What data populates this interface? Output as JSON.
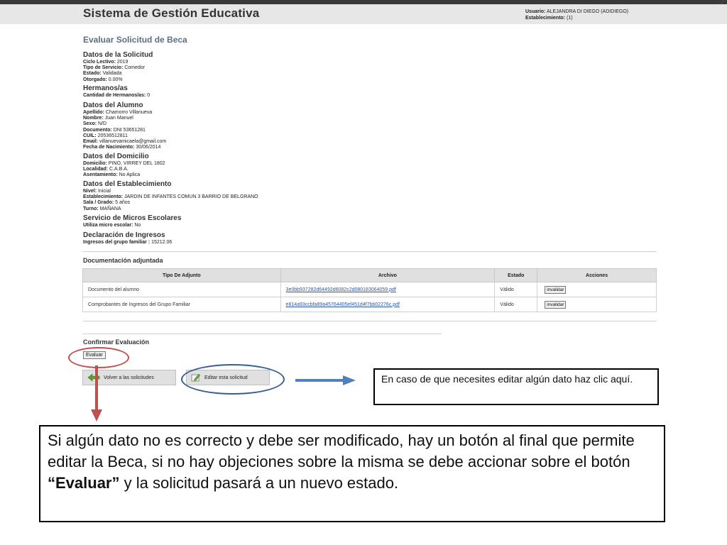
{
  "header": {
    "app_title": "Sistema de Gestión Educativa",
    "user_label": "Usuario:",
    "user_value": "ALEJANDRA DI DIEGO (ADIDIEGO)",
    "establishment_label": "Establecimiento:",
    "establishment_value": "(1)"
  },
  "page_title": "Evaluar Solicitud de Beca",
  "solicitud": {
    "title": "Datos de la Solicitud",
    "rows": [
      {
        "label": "Ciclo Lectivo:",
        "value": "2019"
      },
      {
        "label": "Tipo de Servicio:",
        "value": "Comedor"
      },
      {
        "label": "Estado:",
        "value": "Validada"
      },
      {
        "label": "Otorgado:",
        "value": "0.00%"
      }
    ]
  },
  "hermanos": {
    "title": "Hermanos/as",
    "rows": [
      {
        "label": "Cantidad de Hermanos/as:",
        "value": "0"
      }
    ]
  },
  "alumno": {
    "title": "Datos del Alumno",
    "rows": [
      {
        "label": "Apellido:",
        "value": "Chamorro Villanueva"
      },
      {
        "label": "Nombre:",
        "value": "Juan Manuel"
      },
      {
        "label": "Sexo:",
        "value": "N/D"
      },
      {
        "label": "Documento:",
        "value": "DNI 53651281"
      },
      {
        "label": "CUIL:",
        "value": "20536512811"
      },
      {
        "label": "Email:",
        "value": "villanuevamicaela@gmail.com"
      },
      {
        "label": "Fecha de Nacimiento:",
        "value": "30/06/2014"
      }
    ]
  },
  "domicilio": {
    "title": "Datos del Domicilio",
    "rows": [
      {
        "label": "Domicilio:",
        "value": "PINO, VIRREY DEL 1802"
      },
      {
        "label": "Localidad:",
        "value": "C.A.B.A."
      },
      {
        "label": "Asentamiento:",
        "value": "No Aplica"
      }
    ]
  },
  "establecimiento": {
    "title": "Datos del Establecimiento",
    "rows": [
      {
        "label": "Nivel:",
        "value": "Inicial"
      },
      {
        "label": "Establecimiento:",
        "value": "JARDIN DE INFANTES COMUN 3 BARRIO DE BELGRANO"
      },
      {
        "label": "Sala / Grado:",
        "value": "5 años"
      },
      {
        "label": "Turno:",
        "value": "MAÑANA"
      }
    ]
  },
  "micros": {
    "title": "Servicio de Micros Escolares",
    "rows": [
      {
        "label": "Utiliza micro escolar:",
        "value": "No"
      }
    ]
  },
  "ingresos": {
    "title": "Declaración de Ingresos",
    "rows": [
      {
        "label": "Ingresos del grupo familiar :",
        "value": "15212.06"
      }
    ]
  },
  "documentacion": {
    "title": "Documentación adjuntada",
    "headers": [
      "Tipo De Adjunto",
      "Archivo",
      "Estado",
      "Acciones"
    ],
    "rows": [
      {
        "tipo": "Documento del alumno",
        "archivo": "3e0bb937282d64492d6082c2d080183064059.pdf",
        "estado": "Válido",
        "accion": "invalidar"
      },
      {
        "tipo": "Comprobantes de Ingresos del Grupo Familiar",
        "archivo": "e814a93ccbfa89a45764405ef451d4f7bb02276c.pdf",
        "estado": "Válido",
        "accion": "invalidar"
      }
    ]
  },
  "confirmar": {
    "title": "Confirmar Evaluación",
    "evaluar_label": "Evaluar"
  },
  "buttons": {
    "volver": "Volver a las solicitudes",
    "volver_icon": "arrow-left-icon",
    "editar": "Editar esta solicitud",
    "editar_icon": "edit-icon"
  },
  "annotations": {
    "small_callout": "En caso de que necesites editar algún dato haz clic aquí.",
    "big_callout_part1": "Si algún dato no es correcto y debe ser modificado, hay un botón al final que permite editar la Beca, si no hay objeciones sobre la misma se debe accionar sobre el botón ",
    "big_callout_bold": "“Evaluar”",
    "big_callout_part2": " y la solicitud pasará a un nuevo estado.",
    "red_color": "#c0504d",
    "blue_color": "#365f91",
    "arrow_blue_color": "#4f81bd"
  }
}
